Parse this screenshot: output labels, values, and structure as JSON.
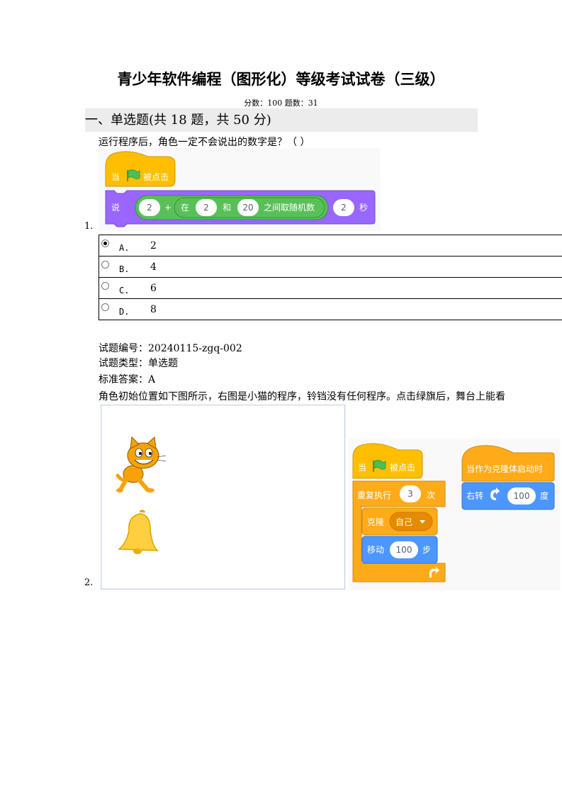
{
  "title": "青少年软件编程（图形化）等级考试试卷（三级）",
  "meta": "分数：100  题数：31",
  "section": "一、单选题(共 18 题，共 50 分)",
  "q1": {
    "number": "1.",
    "text": "运行程序后，角色一定不会说出的数字是？（ ）",
    "blocks": {
      "hat_left": "当",
      "hat_right": "被点击",
      "say": "说",
      "a": "2",
      "plus": "+",
      "in": "在",
      "b": "2",
      "and": "和",
      "c": "20",
      "random": "之间取随机数",
      "secs": "2",
      "sec_unit": "秒"
    },
    "options": [
      {
        "label": "A.",
        "value": "2",
        "selected": true
      },
      {
        "label": "B.",
        "value": "4",
        "selected": false
      },
      {
        "label": "C.",
        "value": "6",
        "selected": false
      },
      {
        "label": "D.",
        "value": "8",
        "selected": false
      }
    ],
    "id_line": "试题编号：20240115-zgq-002",
    "type_line": "试题类型：单选题",
    "answer_line": "标准答案：A"
  },
  "q2": {
    "number": "2.",
    "text": "角色初始位置如下图所示，右图是小猫的程序，铃铛没有任何程序。点击绿旗后，舞台上能看",
    "blocks": {
      "hat_left": "当",
      "hat_right": "被点击",
      "repeat": "重复执行",
      "repeat_n": "3",
      "repeat_unit": "次",
      "clone": "克隆",
      "clone_target": "自己",
      "move": "移动",
      "move_n": "100",
      "move_unit": "步",
      "clone_hat": "当作为克隆体启动时",
      "turn": "右转",
      "turn_n": "100",
      "turn_unit": "度"
    }
  },
  "colors": {
    "events": "#ffbf00",
    "looks": "#9966ff",
    "operators": "#59c059",
    "control": "#ffab19",
    "motion": "#4c97ff"
  }
}
